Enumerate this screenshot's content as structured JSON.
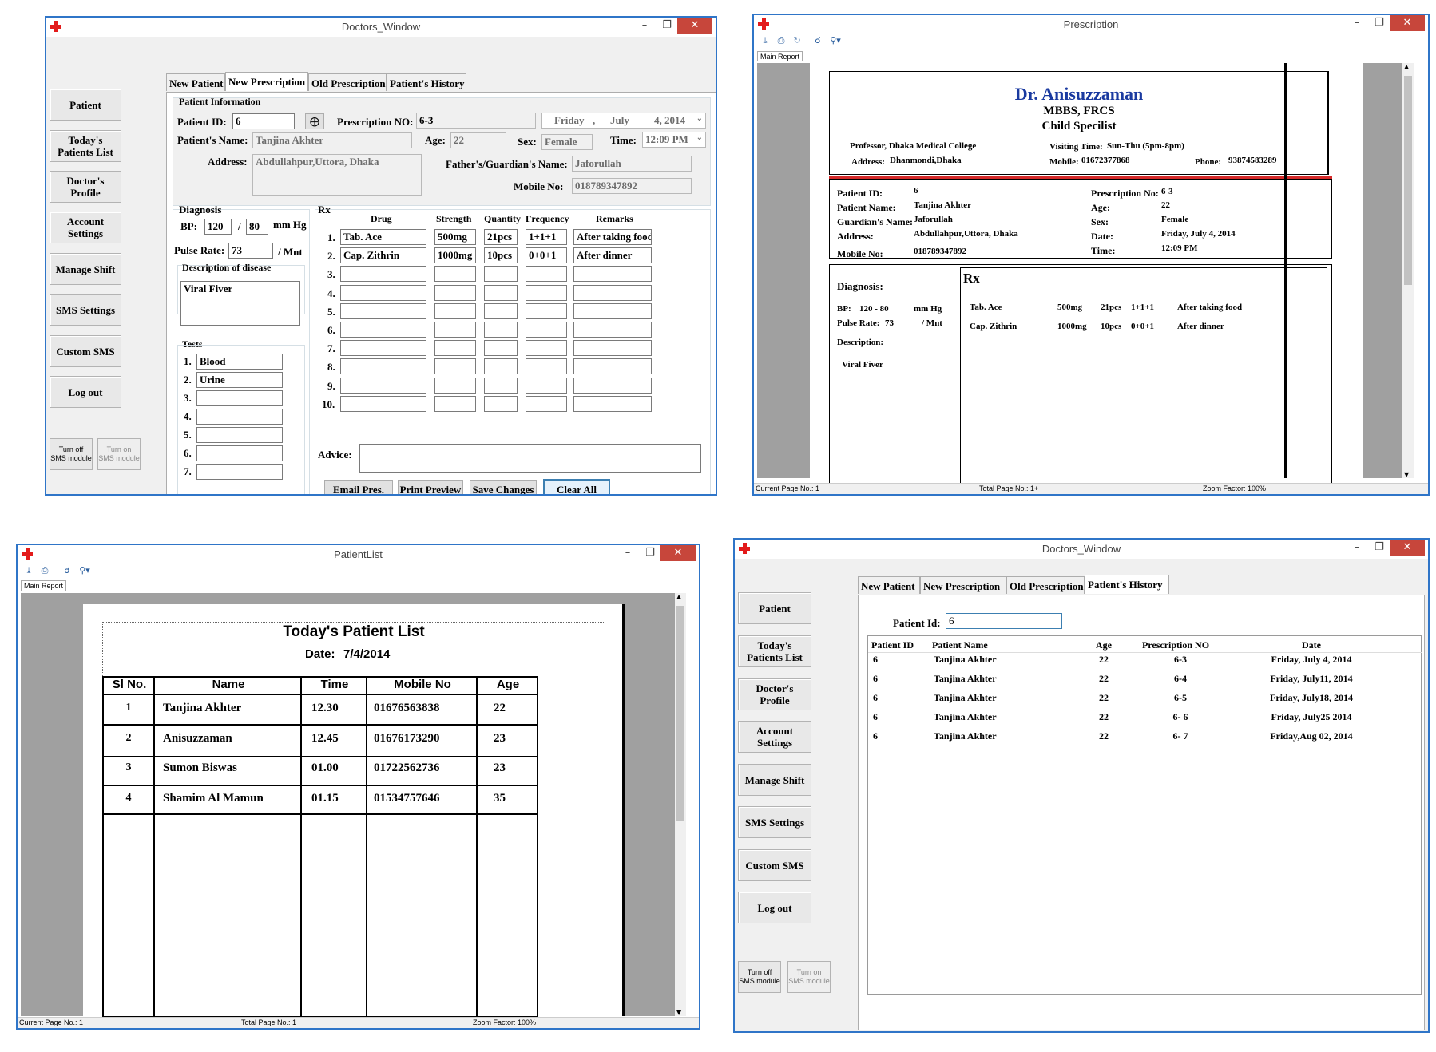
{
  "w1": {
    "title": "Doctors_Window",
    "sidebar": [
      "Patient",
      "Today's Patients List",
      "Doctor's Profile",
      "Account Settings",
      "Manage Shift",
      "SMS Settings",
      "Custom SMS",
      "Log out"
    ],
    "sms_off": "Turn off SMS module",
    "sms_on": "Turn on SMS module",
    "tabs": [
      "New Patient",
      "New Prescription",
      "Old Prescription",
      "Patient's History"
    ],
    "patient_info": "Patient Information",
    "patient_id_label": "Patient ID:",
    "patient_id": "6",
    "presc_no_label": "Prescription NO:",
    "presc_no": "6-3",
    "date_day": "Friday",
    "date_sep": ",",
    "date_month": "July",
    "date_rest": "4, 2014",
    "name_label": "Patient's Name:",
    "name": "Tanjina Akhter",
    "age_label": "Age:",
    "age": "22",
    "sex_label": "Sex:",
    "sex": "Female",
    "time_label": "Time:",
    "time": "12:09 PM",
    "address_label": "Address:",
    "address": "Abdullahpur,Uttora, Dhaka",
    "guardian_label": "Father's/Guardian's Name:",
    "guardian": "Jaforullah",
    "mobile_label": "Mobile No:",
    "mobile": "018789347892",
    "diagnosis": "Diagnosis",
    "bp_label": "BP:",
    "bp_sys": "120",
    "bp_slash": "/",
    "bp_dia": "80",
    "bp_unit": "mm Hg",
    "pulse_label": "Pulse Rate:",
    "pulse": "73",
    "pulse_unit": "/ Mnt",
    "desc_label": "Description of disease",
    "desc": "Viral Fiver",
    "tests_label": "Tests",
    "tests": [
      "Blood",
      "Urine",
      "",
      "",
      "",
      "",
      ""
    ],
    "rx_label": "Rx",
    "rx_headers": [
      "Drug",
      "Strength",
      "Quantity",
      "Frequency",
      "Remarks"
    ],
    "rx_rows": [
      [
        "Tab. Ace",
        "500mg",
        "21pcs",
        "1+1+1",
        "After taking food"
      ],
      [
        "Cap. Zithrin",
        "1000mg",
        "10pcs",
        "0+0+1",
        "After dinner"
      ],
      [
        "",
        "",
        "",
        "",
        ""
      ],
      [
        "",
        "",
        "",
        "",
        ""
      ],
      [
        "",
        "",
        "",
        "",
        ""
      ],
      [
        "",
        "",
        "",
        "",
        ""
      ],
      [
        "",
        "",
        "",
        "",
        ""
      ],
      [
        "",
        "",
        "",
        "",
        ""
      ],
      [
        "",
        "",
        "",
        "",
        ""
      ],
      [
        "",
        "",
        "",
        "",
        ""
      ]
    ],
    "advice_label": "Advice:",
    "buttons": [
      "Email Pres.",
      "Print Preview",
      "Save Changes",
      "Clear All"
    ]
  },
  "w2": {
    "title": "Prescription",
    "report_tab": "Main Report",
    "doctor": "Dr. Anisuzzaman",
    "degree": "MBBS, FRCS",
    "specialty": "Child Specilist",
    "position": "Professor, Dhaka Medical College",
    "visit_label": "Visiting Time:",
    "visit": "Sun-Thu (5pm-8pm)",
    "address_label": "Address:",
    "address": "Dhanmondi,Dhaka",
    "mobile_label": "Mobile:",
    "mobile": "01672377868",
    "phone_label": "Phone:",
    "phone": "93874583289",
    "pid_label": "Patient ID:",
    "pid": "6",
    "pname_label": "Patient Name:",
    "pname": "Tanjina Akhter",
    "guardian_label": "Guardian's Name:",
    "guardian": "Jaforullah",
    "paddr_label": "Address:",
    "paddr": "Abdullahpur,Uttora, Dhaka",
    "pmobile_label": "Mobile No:",
    "pmobile": "018789347892",
    "pno_label": "Prescription No:",
    "pno": "6-3",
    "age_label": "Age:",
    "age": "22",
    "sex_label": "Sex:",
    "sex": "Female",
    "date_label": "Date:",
    "date": "Friday, July 4, 2014",
    "time_label": "Time:",
    "time": "12:09 PM",
    "diag_label": "Diagnosis:",
    "bp_label": "BP:",
    "bp": "120  - 80",
    "bp_unit": "mm Hg",
    "pulse_label": "Pulse Rate:",
    "pulse": "73",
    "pulse_unit": "/ Mnt",
    "desc_label": "Description:",
    "desc": "Viral Fiver",
    "rx": "Rx",
    "rx_rows": [
      [
        "Tab. Ace",
        "500mg",
        "21pcs",
        "1+1+1",
        "After taking food"
      ],
      [
        "Cap. Zithrin",
        "1000mg",
        "10pcs",
        "0+0+1",
        "After dinner"
      ]
    ],
    "status_page": "Current Page No.: 1",
    "status_total": "Total Page No.: 1+",
    "status_zoom": "Zoom Factor: 100%"
  },
  "w3": {
    "title": "PatientList",
    "report_tab": "Main Report",
    "heading": "Today's Patient List",
    "date_label": "Date:",
    "date": "7/4/2014",
    "headers": [
      "Sl No.",
      "Name",
      "Time",
      "Mobile No",
      "Age"
    ],
    "rows": [
      [
        "1",
        "Tanjina Akhter",
        "12.30",
        "01676563838",
        "22"
      ],
      [
        "2",
        "Anisuzzaman",
        "12.45",
        "01676173290",
        "23"
      ],
      [
        "3",
        "Sumon Biswas",
        "01.00",
        "01722562736",
        "23"
      ],
      [
        "4",
        "Shamim Al Mamun",
        "01.15",
        "01534757646",
        "35"
      ]
    ],
    "status_page": "Current Page No.: 1",
    "status_total": "Total Page No.: 1",
    "status_zoom": "Zoom Factor: 100%"
  },
  "w4": {
    "title": "Doctors_Window",
    "sidebar": [
      "Patient",
      "Today's Patients List",
      "Doctor's Profile",
      "Account Settings",
      "Manage Shift",
      "SMS Settings",
      "Custom SMS",
      "Log out"
    ],
    "sms_off": "Turn off SMS module",
    "sms_on": "Turn on SMS module",
    "tabs": [
      "New Patient",
      "New Prescription",
      "Old Prescription",
      "Patient's History"
    ],
    "pid_label": "Patient Id:",
    "pid": "6",
    "headers": [
      "Patient ID",
      "Patient Name",
      "Age",
      "Prescription NO",
      "Date"
    ],
    "rows": [
      [
        "6",
        "Tanjina Akhter",
        "22",
        "6-3",
        "Friday, July 4, 2014"
      ],
      [
        "6",
        "Tanjina Akhter",
        "22",
        "6-4",
        "Friday, July11, 2014"
      ],
      [
        "6",
        "Tanjina Akhter",
        "22",
        "6-5",
        "Friday, July18, 2014"
      ],
      [
        "6",
        "Tanjina Akhter",
        "22",
        "6- 6",
        "Friday, July25 2014"
      ],
      [
        "6",
        "Tanjina Akhter",
        "22",
        "6- 7",
        "Friday,Aug 02, 2014"
      ]
    ]
  }
}
